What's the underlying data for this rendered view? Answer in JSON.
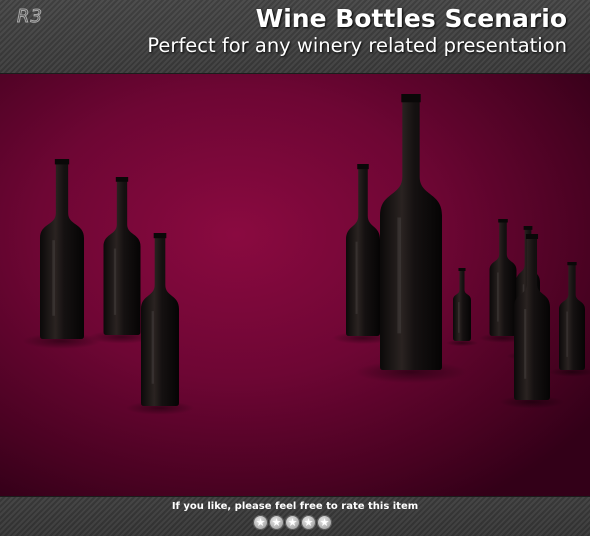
{
  "header": {
    "logo": "R3",
    "title": "Wine Bottles Scenario",
    "subtitle": "Perfect for any winery related presentation"
  },
  "scene": {
    "background_color": "#6e0634",
    "bottle_color": "#161312"
  },
  "footer": {
    "rate_text": "If you like, please feel free to rate this item",
    "stars": [
      "★",
      "★",
      "★",
      "★",
      "★"
    ],
    "star_icon": "star-icon"
  }
}
